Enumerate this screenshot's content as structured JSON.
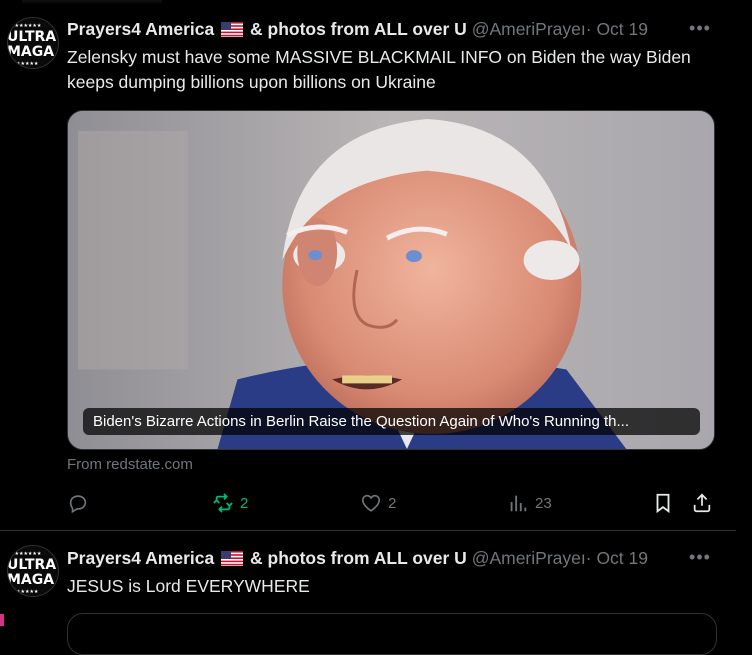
{
  "colors": {
    "background": "#000000",
    "text": "#e7e9ea",
    "muted": "#71767b",
    "divider": "#2f3336",
    "retweet_active": "#00ba7c"
  },
  "tweets": [
    {
      "author": {
        "name_prefix": "Prayers4 America",
        "flag_icon": "us-flag-icon",
        "name_suffix": "& photos from ALL over U",
        "handle": "@AmeriPrayeı",
        "avatar_line1": "ULTRA",
        "avatar_line2": "MAGA"
      },
      "separator": "·",
      "date": "Oct 19",
      "more_icon": "more-icon",
      "text": "Zelensky must have some MASSIVE BLACKMAIL INFO on Biden the way Biden keeps dumping billions upon billions on Ukraine",
      "card": {
        "title": "Biden's Bizarre Actions in Berlin Raise the Question Again of Who's Running th...",
        "source": "From redstate.com"
      },
      "actions": {
        "reply": {
          "icon": "reply-icon",
          "count": ""
        },
        "retweet": {
          "icon": "retweet-icon",
          "count": "2",
          "active": true
        },
        "like": {
          "icon": "heart-icon",
          "count": "2"
        },
        "views": {
          "icon": "views-icon",
          "count": "23"
        },
        "bookmark": {
          "icon": "bookmark-icon"
        },
        "share": {
          "icon": "share-icon"
        }
      }
    },
    {
      "author": {
        "name_prefix": "Prayers4 America",
        "flag_icon": "us-flag-icon",
        "name_suffix": "& photos from ALL over U",
        "handle": "@AmeriPrayeı",
        "avatar_line1": "ULTRA",
        "avatar_line2": "MAGA"
      },
      "separator": "·",
      "date": "Oct 19",
      "more_icon": "more-icon",
      "text": "JESUS is Lord EVERYWHERE"
    }
  ]
}
